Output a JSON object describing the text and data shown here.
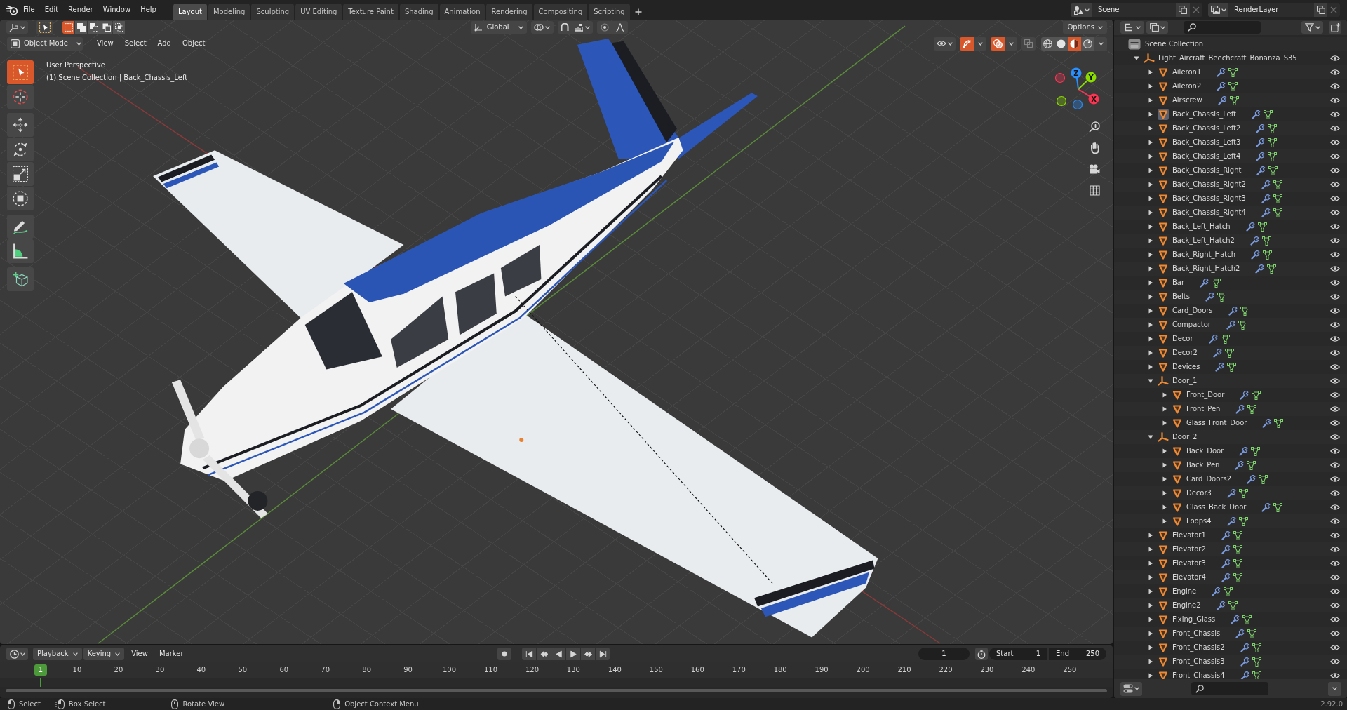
{
  "topbar": {
    "menus": [
      "File",
      "Edit",
      "Render",
      "Window",
      "Help"
    ],
    "workspaces": [
      {
        "label": "Layout",
        "selected": true
      },
      {
        "label": "Modeling",
        "selected": false
      },
      {
        "label": "Sculpting",
        "selected": false
      },
      {
        "label": "UV Editing",
        "selected": false
      },
      {
        "label": "Texture Paint",
        "selected": false
      },
      {
        "label": "Shading",
        "selected": false
      },
      {
        "label": "Animation",
        "selected": false
      },
      {
        "label": "Rendering",
        "selected": false
      },
      {
        "label": "Compositing",
        "selected": false
      },
      {
        "label": "Scripting",
        "selected": false
      }
    ],
    "scene": "Scene",
    "view_layer": "RenderLayer"
  },
  "tool_header": {
    "select_modes": [
      {
        "kind": "set",
        "selected": true
      },
      {
        "kind": "extend",
        "selected": false
      },
      {
        "kind": "subtract",
        "selected": false
      },
      {
        "kind": "difference",
        "selected": false
      },
      {
        "kind": "intersect",
        "selected": false
      }
    ],
    "orientation": "Global",
    "options": "Options"
  },
  "viewport_header": {
    "mode": "Object Mode",
    "menus": [
      "View",
      "Select",
      "Add",
      "Object"
    ],
    "toggles": [
      {
        "kind": "gizmo",
        "on": true
      },
      {
        "kind": "overlay",
        "on": true
      },
      {
        "kind": "xray",
        "on": false
      }
    ],
    "shading": [
      {
        "kind": "wireframe",
        "selected": false
      },
      {
        "kind": "solid",
        "selected": false
      },
      {
        "kind": "material",
        "selected": true
      },
      {
        "kind": "rendered",
        "selected": false
      }
    ]
  },
  "viewport": {
    "view_name": "User Perspective",
    "context": "(1) Scene Collection | Back_Chassis_Left",
    "tool_groups": [
      [
        {
          "kind": "select_box",
          "selected": true
        },
        {
          "kind": "cursor",
          "selected": false
        }
      ],
      [
        {
          "kind": "move",
          "selected": false
        },
        {
          "kind": "rotate",
          "selected": false
        },
        {
          "kind": "scale",
          "selected": false
        },
        {
          "kind": "transform",
          "selected": false
        }
      ],
      [
        {
          "kind": "annotate",
          "selected": false
        },
        {
          "kind": "measure",
          "selected": false
        }
      ],
      [
        {
          "kind": "add_cube",
          "selected": false
        }
      ]
    ],
    "gizmo_axes": [
      {
        "label": "X",
        "color": "#ff3352"
      },
      {
        "label": "Y",
        "color": "#8bdc00"
      },
      {
        "label": "Z",
        "color": "#2890ff"
      }
    ]
  },
  "timeline": {
    "menus": [
      {
        "label": "Playback",
        "kind": "dropdown"
      },
      {
        "label": "Keying",
        "kind": "dropdown"
      },
      {
        "label": "View",
        "kind": "menu"
      },
      {
        "label": "Marker",
        "kind": "menu"
      }
    ],
    "frame": "1",
    "start_label": "Start",
    "start": "1",
    "end_label": "End",
    "end": "250",
    "ruler_current": "1",
    "frame_labels": [
      "10",
      "20",
      "30",
      "40",
      "50",
      "60",
      "70",
      "80",
      "90",
      "100",
      "110",
      "120",
      "130",
      "140",
      "150",
      "160",
      "170",
      "180",
      "190",
      "200",
      "210",
      "220",
      "230",
      "240",
      "250"
    ]
  },
  "outliner": {
    "root": "Scene Collection",
    "items": [
      {
        "name": "Light_Aircraft_Beechcraft_Bonanza_S35",
        "kind": "empty",
        "expanded": true,
        "active": false,
        "children": [
          {
            "name": "Aileron1",
            "kind": "mesh",
            "expanded": false,
            "active": false
          },
          {
            "name": "Aileron2",
            "kind": "mesh",
            "expanded": false,
            "active": false
          },
          {
            "name": "Airscrew",
            "kind": "mesh",
            "expanded": false,
            "active": false
          },
          {
            "name": "Back_Chassis_Left",
            "kind": "mesh",
            "expanded": false,
            "active": true
          },
          {
            "name": "Back_Chassis_Left2",
            "kind": "mesh",
            "expanded": false,
            "active": false
          },
          {
            "name": "Back_Chassis_Left3",
            "kind": "mesh",
            "expanded": false,
            "active": false
          },
          {
            "name": "Back_Chassis_Left4",
            "kind": "mesh",
            "expanded": false,
            "active": false
          },
          {
            "name": "Back_Chassis_Right",
            "kind": "mesh",
            "expanded": false,
            "active": false
          },
          {
            "name": "Back_Chassis_Right2",
            "kind": "mesh",
            "expanded": false,
            "active": false
          },
          {
            "name": "Back_Chassis_Right3",
            "kind": "mesh",
            "expanded": false,
            "active": false
          },
          {
            "name": "Back_Chassis_Right4",
            "kind": "mesh",
            "expanded": false,
            "active": false
          },
          {
            "name": "Back_Left_Hatch",
            "kind": "mesh",
            "expanded": false,
            "active": false
          },
          {
            "name": "Back_Left_Hatch2",
            "kind": "mesh",
            "expanded": false,
            "active": false
          },
          {
            "name": "Back_Right_Hatch",
            "kind": "mesh",
            "expanded": false,
            "active": false
          },
          {
            "name": "Back_Right_Hatch2",
            "kind": "mesh",
            "expanded": false,
            "active": false
          },
          {
            "name": "Bar",
            "kind": "mesh",
            "expanded": false,
            "active": false
          },
          {
            "name": "Belts",
            "kind": "mesh",
            "expanded": false,
            "active": false
          },
          {
            "name": "Card_Doors",
            "kind": "mesh",
            "expanded": false,
            "active": false
          },
          {
            "name": "Compactor",
            "kind": "mesh",
            "expanded": false,
            "active": false
          },
          {
            "name": "Decor",
            "kind": "mesh",
            "expanded": false,
            "active": false
          },
          {
            "name": "Decor2",
            "kind": "mesh",
            "expanded": false,
            "active": false
          },
          {
            "name": "Devices",
            "kind": "mesh",
            "expanded": false,
            "active": false
          },
          {
            "name": "Door_1",
            "kind": "empty",
            "expanded": true,
            "active": false,
            "children": [
              {
                "name": "Front_Door",
                "kind": "mesh",
                "expanded": false,
                "active": false
              },
              {
                "name": "Front_Pen",
                "kind": "mesh",
                "expanded": false,
                "active": false
              },
              {
                "name": "Glass_Front_Door",
                "kind": "mesh",
                "expanded": false,
                "active": false
              }
            ]
          },
          {
            "name": "Door_2",
            "kind": "empty",
            "expanded": true,
            "active": false,
            "children": [
              {
                "name": "Back_Door",
                "kind": "mesh",
                "expanded": false,
                "active": false
              },
              {
                "name": "Back_Pen",
                "kind": "mesh",
                "expanded": false,
                "active": false
              },
              {
                "name": "Card_Doors2",
                "kind": "mesh",
                "expanded": false,
                "active": false
              },
              {
                "name": "Decor3",
                "kind": "mesh",
                "expanded": false,
                "active": false
              },
              {
                "name": "Glass_Back_Door",
                "kind": "mesh",
                "expanded": false,
                "active": false
              },
              {
                "name": "Loops4",
                "kind": "mesh",
                "expanded": false,
                "active": false
              }
            ]
          },
          {
            "name": "Elevator1",
            "kind": "mesh",
            "expanded": false,
            "active": false
          },
          {
            "name": "Elevator2",
            "kind": "mesh",
            "expanded": false,
            "active": false
          },
          {
            "name": "Elevator3",
            "kind": "mesh",
            "expanded": false,
            "active": false
          },
          {
            "name": "Elevator4",
            "kind": "mesh",
            "expanded": false,
            "active": false
          },
          {
            "name": "Engine",
            "kind": "mesh",
            "expanded": false,
            "active": false
          },
          {
            "name": "Engine2",
            "kind": "mesh",
            "expanded": false,
            "active": false
          },
          {
            "name": "Fixing_Glass",
            "kind": "mesh",
            "expanded": false,
            "active": false
          },
          {
            "name": "Front_Chassis",
            "kind": "mesh",
            "expanded": false,
            "active": false
          },
          {
            "name": "Front_Chassis2",
            "kind": "mesh",
            "expanded": false,
            "active": false
          },
          {
            "name": "Front_Chassis3",
            "kind": "mesh",
            "expanded": false,
            "active": false
          },
          {
            "name": "Front_Chassis4",
            "kind": "mesh",
            "expanded": false,
            "active": false
          }
        ]
      }
    ]
  },
  "status_bar": {
    "hints": [
      {
        "kind": "left_click",
        "label": "Select"
      },
      {
        "kind": "drag",
        "label": "Box Select"
      },
      {
        "kind": "middle",
        "label": "Rotate View"
      },
      {
        "kind": "right_click",
        "label": "Object Context Menu"
      }
    ],
    "version": "2.92.0"
  }
}
